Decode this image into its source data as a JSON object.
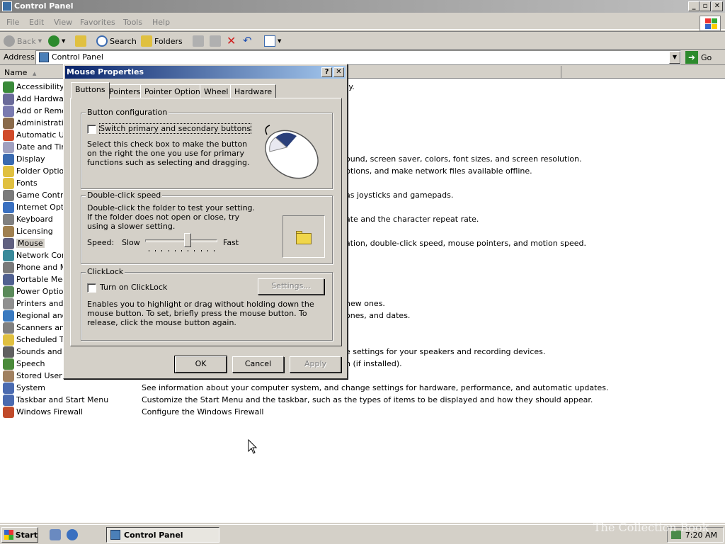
{
  "window": {
    "title": "Control Panel",
    "minimize": "_",
    "maximize": "▫",
    "close": "✕"
  },
  "menu": [
    "File",
    "Edit",
    "View",
    "Favorites",
    "Tools",
    "Help"
  ],
  "toolbar": {
    "back": "Back",
    "search": "Search",
    "folders": "Folders"
  },
  "address": {
    "label": "Address",
    "value": "Control Panel",
    "go": "Go"
  },
  "columns": {
    "name": "Name"
  },
  "items": [
    {
      "name": "Accessibility C",
      "icon_color": "#3a8a3a",
      "comment": "ty."
    },
    {
      "name": "Add Hardware",
      "icon_color": "#6a6a9a",
      "comment": ""
    },
    {
      "name": "Add or Remov",
      "icon_color": "#7a7ab0",
      "comment": ""
    },
    {
      "name": "Administrative",
      "icon_color": "#8a6a4a",
      "comment": ""
    },
    {
      "name": "Automatic Up",
      "icon_color": "#d04a2a",
      "comment": ""
    },
    {
      "name": "Date and Tim",
      "icon_color": "#a0a0c0",
      "comment": ""
    },
    {
      "name": "Display",
      "icon_color": "#3a6ab0",
      "comment": "ound, screen saver, colors, font sizes, and screen resolution."
    },
    {
      "name": "Folder Option",
      "icon_color": "#e0c040",
      "comment": "ptions, and make network files available offline."
    },
    {
      "name": "Fonts",
      "icon_color": "#e0c040",
      "comment": ""
    },
    {
      "name": "Game Control",
      "icon_color": "#7a7a7a",
      "comment": "as joysticks and gamepads."
    },
    {
      "name": "Internet Optic",
      "icon_color": "#3a70c0",
      "comment": ""
    },
    {
      "name": "Keyboard",
      "icon_color": "#808080",
      "comment": "ate and the character repeat rate."
    },
    {
      "name": "Licensing",
      "icon_color": "#a08050",
      "comment": ""
    },
    {
      "name": "Mouse",
      "icon_color": "#606080",
      "comment": "ation, double-click speed, mouse pointers, and motion speed."
    },
    {
      "name": "Network Conn",
      "icon_color": "#3a8a9a",
      "comment": ""
    },
    {
      "name": "Phone and Mo",
      "icon_color": "#7a7a7a",
      "comment": ""
    },
    {
      "name": "Portable Medi",
      "icon_color": "#506090",
      "comment": "."
    },
    {
      "name": "Power Option",
      "icon_color": "#5a8a5a",
      "comment": ""
    },
    {
      "name": "Printers and F",
      "icon_color": "#909090",
      "comment": "new ones."
    },
    {
      "name": "Regional and",
      "icon_color": "#3a7ac0",
      "comment": "ones, and dates."
    },
    {
      "name": "Scanners and",
      "icon_color": "#808080",
      "comment": ""
    },
    {
      "name": "Scheduled Ta",
      "icon_color": "#e0c040",
      "comment": ""
    },
    {
      "name": "Sounds and A",
      "icon_color": "#606060",
      "comment": "e settings for your speakers and recording devices."
    },
    {
      "name": "Speech",
      "icon_color": "#4a8a3a",
      "comment": "n (if installed)."
    },
    {
      "name": "Stored User N",
      "icon_color": "#a08060",
      "comment": ""
    },
    {
      "name": "System",
      "icon_color": "#4a6ab0",
      "comment": "See information about your computer system, and change settings for hardware, performance, and automatic updates."
    },
    {
      "name": "Taskbar and Start Menu",
      "icon_color": "#4a6ab0",
      "comment": "Customize the Start Menu and the taskbar, such as the types of items to be displayed and how they should appear."
    },
    {
      "name": "Windows Firewall",
      "icon_color": "#c04a2a",
      "comment": "Configure the Windows Firewall"
    }
  ],
  "dialog": {
    "title": "Mouse Properties",
    "help": "?",
    "close": "✕",
    "tabs": [
      "Buttons",
      "Pointers",
      "Pointer Options",
      "Wheel",
      "Hardware"
    ],
    "button_config": {
      "label": "Button configuration",
      "checkbox": "Switch primary and secondary buttons",
      "desc": "Select this check box to make the button on the right the one you use for primary functions such as selecting and dragging."
    },
    "double_click": {
      "label": "Double-click speed",
      "desc": "Double-click the folder to test your setting. If the folder does not open or close, try using a slower setting.",
      "speed_label": "Speed:",
      "slow": "Slow",
      "fast": "Fast",
      "level": 0.6
    },
    "clicklock": {
      "label": "ClickLock",
      "checkbox": "Turn on ClickLock",
      "settings": "Settings...",
      "desc": "Enables you to highlight or drag without holding down the mouse button. To set, briefly press the mouse button. To release, click the mouse button again."
    },
    "ok": "OK",
    "cancel": "Cancel",
    "apply": "Apply"
  },
  "taskbar": {
    "start": "Start",
    "task": "Control Panel",
    "clock": "7:20 AM",
    "watermark": "The Collection Book"
  }
}
